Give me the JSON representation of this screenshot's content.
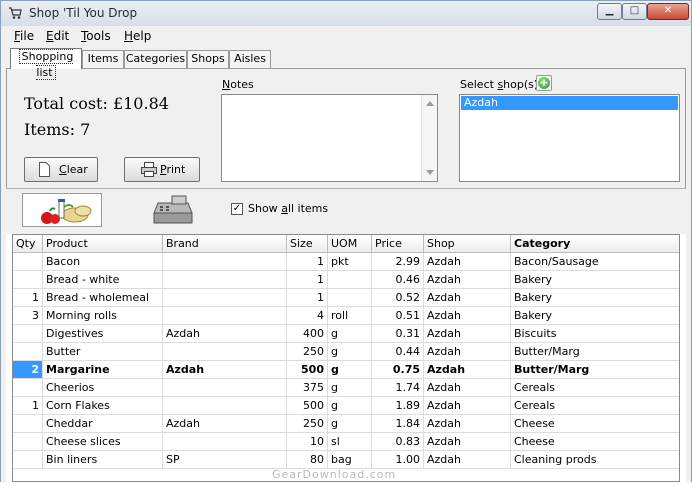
{
  "window": {
    "title": "Shop 'Til You Drop"
  },
  "menu": [
    {
      "label": "File",
      "key": "F",
      "rest": "ile"
    },
    {
      "label": "Edit",
      "key": "E",
      "rest": "dit"
    },
    {
      "label": "Tools",
      "key": "T",
      "rest": "ools"
    },
    {
      "label": "Help",
      "key": "H",
      "rest": "elp"
    }
  ],
  "tabs": [
    "Shopping list",
    "Items",
    "Categories",
    "Shops",
    "Aisles"
  ],
  "summary": {
    "total_cost": "Total cost: £10.84",
    "items": "Items: 7"
  },
  "buttons": {
    "clear_key": "C",
    "clear_rest": "lear",
    "print_key": "P",
    "print_rest": "rint"
  },
  "notes": {
    "label_key": "N",
    "label_rest": "otes",
    "value": ""
  },
  "shops": {
    "label_pre": "Select ",
    "label_key": "s",
    "label_rest": "hop(s)",
    "list": [
      "Azdah"
    ]
  },
  "show_all": {
    "pre": "Show ",
    "key": "a",
    "rest": "ll items",
    "checked": "✓"
  },
  "grid": {
    "columns": [
      "Qty",
      "Product",
      "Brand",
      "Size",
      "UOM",
      "Price",
      "Shop",
      "Category"
    ],
    "rows": [
      {
        "qty": "",
        "product": "Bacon",
        "brand": "",
        "size": "1",
        "uom": "pkt",
        "price": "2.99",
        "shop": "Azdah",
        "category": "Bacon/Sausage"
      },
      {
        "qty": "",
        "product": "Bread - white",
        "brand": "",
        "size": "1",
        "uom": "",
        "price": "0.46",
        "shop": "Azdah",
        "category": "Bakery"
      },
      {
        "qty": "1",
        "product": "Bread - wholemeal",
        "brand": "",
        "size": "1",
        "uom": "",
        "price": "0.52",
        "shop": "Azdah",
        "category": "Bakery"
      },
      {
        "qty": "3",
        "product": "Morning rolls",
        "brand": "",
        "size": "4",
        "uom": "roll",
        "price": "0.51",
        "shop": "Azdah",
        "category": "Bakery"
      },
      {
        "qty": "",
        "product": "Digestives",
        "brand": "Azdah",
        "size": "400",
        "uom": "g",
        "price": "0.31",
        "shop": "Azdah",
        "category": "Biscuits"
      },
      {
        "qty": "",
        "product": "Butter",
        "brand": "",
        "size": "250",
        "uom": "g",
        "price": "0.44",
        "shop": "Azdah",
        "category": "Butter/Marg"
      },
      {
        "qty": "2",
        "product": "Margarine",
        "brand": "Azdah",
        "size": "500",
        "uom": "g",
        "price": "0.75",
        "shop": "Azdah",
        "category": "Butter/Marg"
      },
      {
        "qty": "",
        "product": "Cheerios",
        "brand": "",
        "size": "375",
        "uom": "g",
        "price": "1.74",
        "shop": "Azdah",
        "category": "Cereals"
      },
      {
        "qty": "1",
        "product": "Corn Flakes",
        "brand": "",
        "size": "500",
        "uom": "g",
        "price": "1.89",
        "shop": "Azdah",
        "category": "Cereals"
      },
      {
        "qty": "",
        "product": "Cheddar",
        "brand": "Azdah",
        "size": "250",
        "uom": "g",
        "price": "1.84",
        "shop": "Azdah",
        "category": "Cheese"
      },
      {
        "qty": "",
        "product": "Cheese slices",
        "brand": "",
        "size": "10",
        "uom": "sl",
        "price": "0.83",
        "shop": "Azdah",
        "category": "Cheese"
      },
      {
        "qty": "",
        "product": "Bin liners",
        "brand": "SP",
        "size": "80",
        "uom": "bag",
        "price": "1.00",
        "shop": "Azdah",
        "category": "Cleaning prods"
      }
    ]
  },
  "watermark": "GearDownload.com"
}
